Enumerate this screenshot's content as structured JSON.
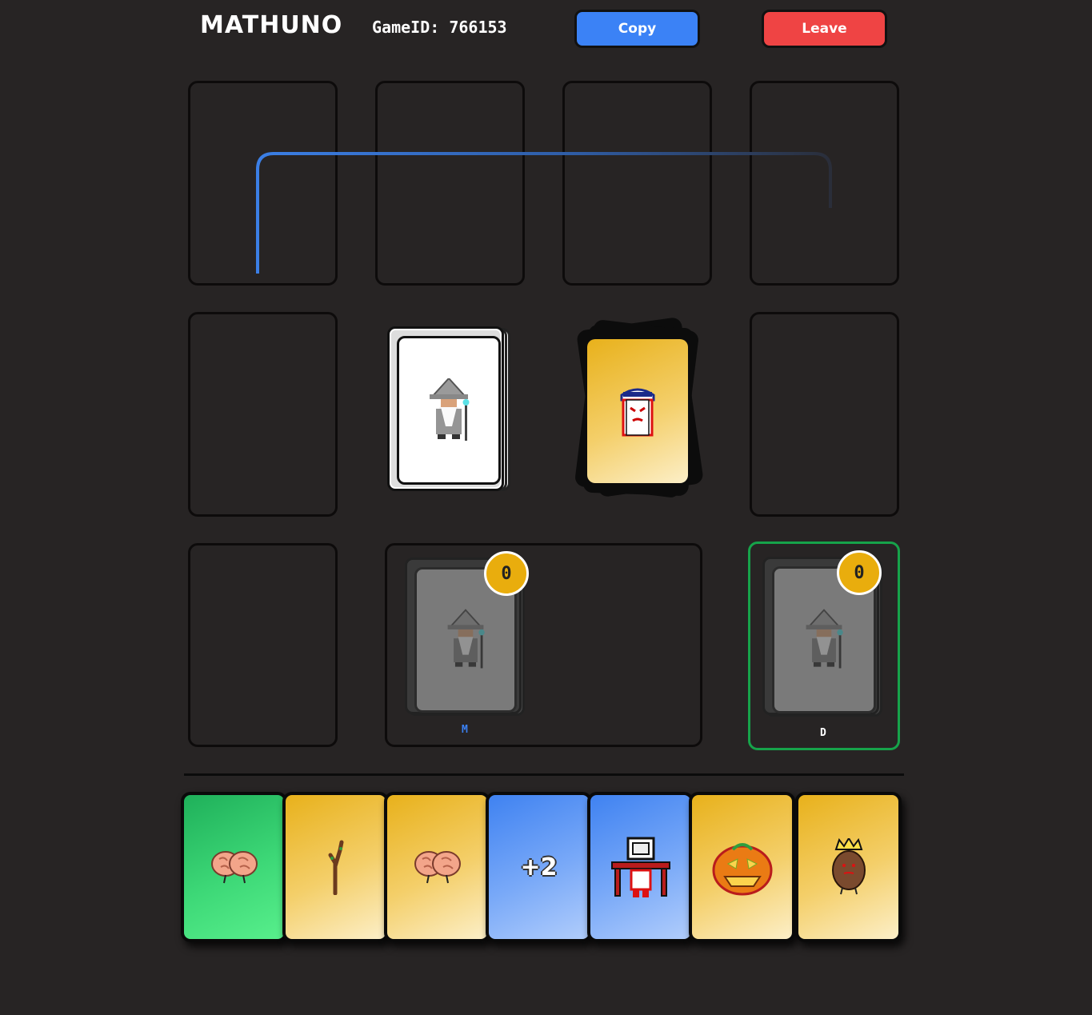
{
  "header": {
    "title": "MATHUNO",
    "game_id_label": "GameID:",
    "game_id_value": "766153",
    "copy_label": "Copy",
    "leave_label": "Leave"
  },
  "table": {
    "draw_pile_card": "wizard-icon",
    "discard_top_card": {
      "icon": "angry-sailor-cup-icon",
      "color": "yellow"
    }
  },
  "players": [
    {
      "name": "M",
      "score": "0",
      "name_color": "#3b82f6",
      "active": false
    },
    {
      "name": "D",
      "score": "0",
      "name_color": "#ffffff",
      "active": true,
      "highlight_color": "#16a34a"
    }
  ],
  "hand": [
    {
      "color": "green",
      "icon": "brain-icon"
    },
    {
      "color": "yellow",
      "icon": "branch-icon"
    },
    {
      "color": "yellow",
      "icon": "brain-icon"
    },
    {
      "color": "blue",
      "label": "+2"
    },
    {
      "color": "blue",
      "icon": "desk-chair-icon"
    },
    {
      "color": "yellow",
      "icon": "pumpkin-icon"
    },
    {
      "color": "yellow",
      "icon": "crowned-potato-icon"
    }
  ],
  "colors": {
    "accent_blue": "#3b82f6",
    "accent_red": "#ef4444",
    "badge_gold": "#e9ad0d",
    "bg": "#272424"
  }
}
